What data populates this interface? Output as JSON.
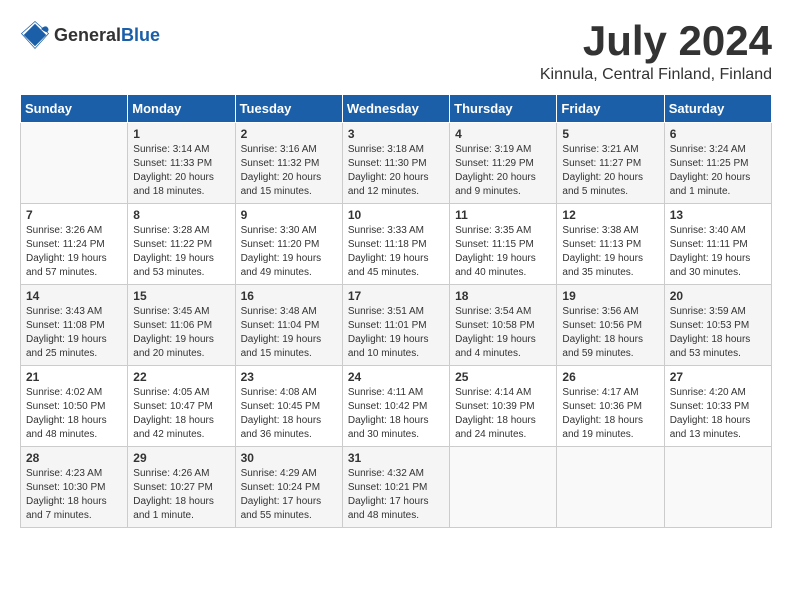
{
  "header": {
    "logo_general": "General",
    "logo_blue": "Blue",
    "month_year": "July 2024",
    "location": "Kinnula, Central Finland, Finland"
  },
  "days_of_week": [
    "Sunday",
    "Monday",
    "Tuesday",
    "Wednesday",
    "Thursday",
    "Friday",
    "Saturday"
  ],
  "weeks": [
    [
      {
        "day": "",
        "sunrise": "",
        "sunset": "",
        "daylight": ""
      },
      {
        "day": "1",
        "sunrise": "Sunrise: 3:14 AM",
        "sunset": "Sunset: 11:33 PM",
        "daylight": "Daylight: 20 hours and 18 minutes."
      },
      {
        "day": "2",
        "sunrise": "Sunrise: 3:16 AM",
        "sunset": "Sunset: 11:32 PM",
        "daylight": "Daylight: 20 hours and 15 minutes."
      },
      {
        "day": "3",
        "sunrise": "Sunrise: 3:18 AM",
        "sunset": "Sunset: 11:30 PM",
        "daylight": "Daylight: 20 hours and 12 minutes."
      },
      {
        "day": "4",
        "sunrise": "Sunrise: 3:19 AM",
        "sunset": "Sunset: 11:29 PM",
        "daylight": "Daylight: 20 hours and 9 minutes."
      },
      {
        "day": "5",
        "sunrise": "Sunrise: 3:21 AM",
        "sunset": "Sunset: 11:27 PM",
        "daylight": "Daylight: 20 hours and 5 minutes."
      },
      {
        "day": "6",
        "sunrise": "Sunrise: 3:24 AM",
        "sunset": "Sunset: 11:25 PM",
        "daylight": "Daylight: 20 hours and 1 minute."
      }
    ],
    [
      {
        "day": "7",
        "sunrise": "Sunrise: 3:26 AM",
        "sunset": "Sunset: 11:24 PM",
        "daylight": "Daylight: 19 hours and 57 minutes."
      },
      {
        "day": "8",
        "sunrise": "Sunrise: 3:28 AM",
        "sunset": "Sunset: 11:22 PM",
        "daylight": "Daylight: 19 hours and 53 minutes."
      },
      {
        "day": "9",
        "sunrise": "Sunrise: 3:30 AM",
        "sunset": "Sunset: 11:20 PM",
        "daylight": "Daylight: 19 hours and 49 minutes."
      },
      {
        "day": "10",
        "sunrise": "Sunrise: 3:33 AM",
        "sunset": "Sunset: 11:18 PM",
        "daylight": "Daylight: 19 hours and 45 minutes."
      },
      {
        "day": "11",
        "sunrise": "Sunrise: 3:35 AM",
        "sunset": "Sunset: 11:15 PM",
        "daylight": "Daylight: 19 hours and 40 minutes."
      },
      {
        "day": "12",
        "sunrise": "Sunrise: 3:38 AM",
        "sunset": "Sunset: 11:13 PM",
        "daylight": "Daylight: 19 hours and 35 minutes."
      },
      {
        "day": "13",
        "sunrise": "Sunrise: 3:40 AM",
        "sunset": "Sunset: 11:11 PM",
        "daylight": "Daylight: 19 hours and 30 minutes."
      }
    ],
    [
      {
        "day": "14",
        "sunrise": "Sunrise: 3:43 AM",
        "sunset": "Sunset: 11:08 PM",
        "daylight": "Daylight: 19 hours and 25 minutes."
      },
      {
        "day": "15",
        "sunrise": "Sunrise: 3:45 AM",
        "sunset": "Sunset: 11:06 PM",
        "daylight": "Daylight: 19 hours and 20 minutes."
      },
      {
        "day": "16",
        "sunrise": "Sunrise: 3:48 AM",
        "sunset": "Sunset: 11:04 PM",
        "daylight": "Daylight: 19 hours and 15 minutes."
      },
      {
        "day": "17",
        "sunrise": "Sunrise: 3:51 AM",
        "sunset": "Sunset: 11:01 PM",
        "daylight": "Daylight: 19 hours and 10 minutes."
      },
      {
        "day": "18",
        "sunrise": "Sunrise: 3:54 AM",
        "sunset": "Sunset: 10:58 PM",
        "daylight": "Daylight: 19 hours and 4 minutes."
      },
      {
        "day": "19",
        "sunrise": "Sunrise: 3:56 AM",
        "sunset": "Sunset: 10:56 PM",
        "daylight": "Daylight: 18 hours and 59 minutes."
      },
      {
        "day": "20",
        "sunrise": "Sunrise: 3:59 AM",
        "sunset": "Sunset: 10:53 PM",
        "daylight": "Daylight: 18 hours and 53 minutes."
      }
    ],
    [
      {
        "day": "21",
        "sunrise": "Sunrise: 4:02 AM",
        "sunset": "Sunset: 10:50 PM",
        "daylight": "Daylight: 18 hours and 48 minutes."
      },
      {
        "day": "22",
        "sunrise": "Sunrise: 4:05 AM",
        "sunset": "Sunset: 10:47 PM",
        "daylight": "Daylight: 18 hours and 42 minutes."
      },
      {
        "day": "23",
        "sunrise": "Sunrise: 4:08 AM",
        "sunset": "Sunset: 10:45 PM",
        "daylight": "Daylight: 18 hours and 36 minutes."
      },
      {
        "day": "24",
        "sunrise": "Sunrise: 4:11 AM",
        "sunset": "Sunset: 10:42 PM",
        "daylight": "Daylight: 18 hours and 30 minutes."
      },
      {
        "day": "25",
        "sunrise": "Sunrise: 4:14 AM",
        "sunset": "Sunset: 10:39 PM",
        "daylight": "Daylight: 18 hours and 24 minutes."
      },
      {
        "day": "26",
        "sunrise": "Sunrise: 4:17 AM",
        "sunset": "Sunset: 10:36 PM",
        "daylight": "Daylight: 18 hours and 19 minutes."
      },
      {
        "day": "27",
        "sunrise": "Sunrise: 4:20 AM",
        "sunset": "Sunset: 10:33 PM",
        "daylight": "Daylight: 18 hours and 13 minutes."
      }
    ],
    [
      {
        "day": "28",
        "sunrise": "Sunrise: 4:23 AM",
        "sunset": "Sunset: 10:30 PM",
        "daylight": "Daylight: 18 hours and 7 minutes."
      },
      {
        "day": "29",
        "sunrise": "Sunrise: 4:26 AM",
        "sunset": "Sunset: 10:27 PM",
        "daylight": "Daylight: 18 hours and 1 minute."
      },
      {
        "day": "30",
        "sunrise": "Sunrise: 4:29 AM",
        "sunset": "Sunset: 10:24 PM",
        "daylight": "Daylight: 17 hours and 55 minutes."
      },
      {
        "day": "31",
        "sunrise": "Sunrise: 4:32 AM",
        "sunset": "Sunset: 10:21 PM",
        "daylight": "Daylight: 17 hours and 48 minutes."
      },
      {
        "day": "",
        "sunrise": "",
        "sunset": "",
        "daylight": ""
      },
      {
        "day": "",
        "sunrise": "",
        "sunset": "",
        "daylight": ""
      },
      {
        "day": "",
        "sunrise": "",
        "sunset": "",
        "daylight": ""
      }
    ]
  ]
}
